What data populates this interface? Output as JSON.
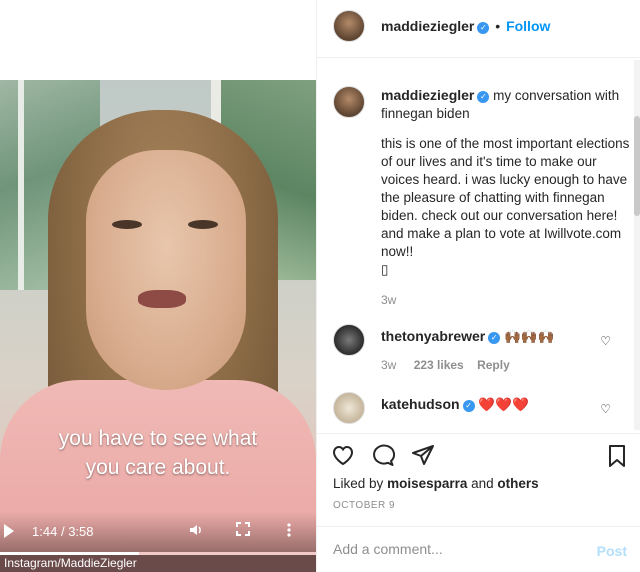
{
  "video": {
    "caption_line1": "you have to see what",
    "caption_line2": "you care about.",
    "current_time": "1:44",
    "duration": "3:58",
    "separator": "/",
    "progress": 0.44,
    "credit": "Instagram/MaddieZiegler",
    "icons": [
      "play-icon",
      "volume-icon",
      "fullscreen-icon",
      "more-vertical-icon"
    ]
  },
  "header": {
    "username": "maddieziegler",
    "follow_label": "Follow",
    "dot": "•"
  },
  "post": {
    "username": "maddieziegler",
    "title": "my conversation with finnegan biden",
    "body": "this is one of the most important elections of our lives and it's time to make our voices heard. i was lucky enough to have the pleasure of chatting with finnegan biden. check out our conversation here! and make a plan to vote at Iwillvote.com now!!",
    "trailing_glyph": "▯",
    "age": "3w"
  },
  "comments": [
    {
      "username": "thetonyabrewer",
      "text": "🙌🏾🙌🏾🙌🏾",
      "age": "3w",
      "likes": "223 likes",
      "reply": "Reply"
    },
    {
      "username": "katehudson",
      "text": "❤️❤️❤️"
    }
  ],
  "likes_line": {
    "prefix": "Liked by",
    "user": "moisesparra",
    "and": "and",
    "others": "others"
  },
  "date": "OCTOBER 9",
  "add_comment": {
    "placeholder": "Add a comment...",
    "post_label": "Post"
  },
  "colors": {
    "accent": "#0095f6",
    "verified": "#3897f0",
    "post_disabled": "#b2dffc"
  }
}
